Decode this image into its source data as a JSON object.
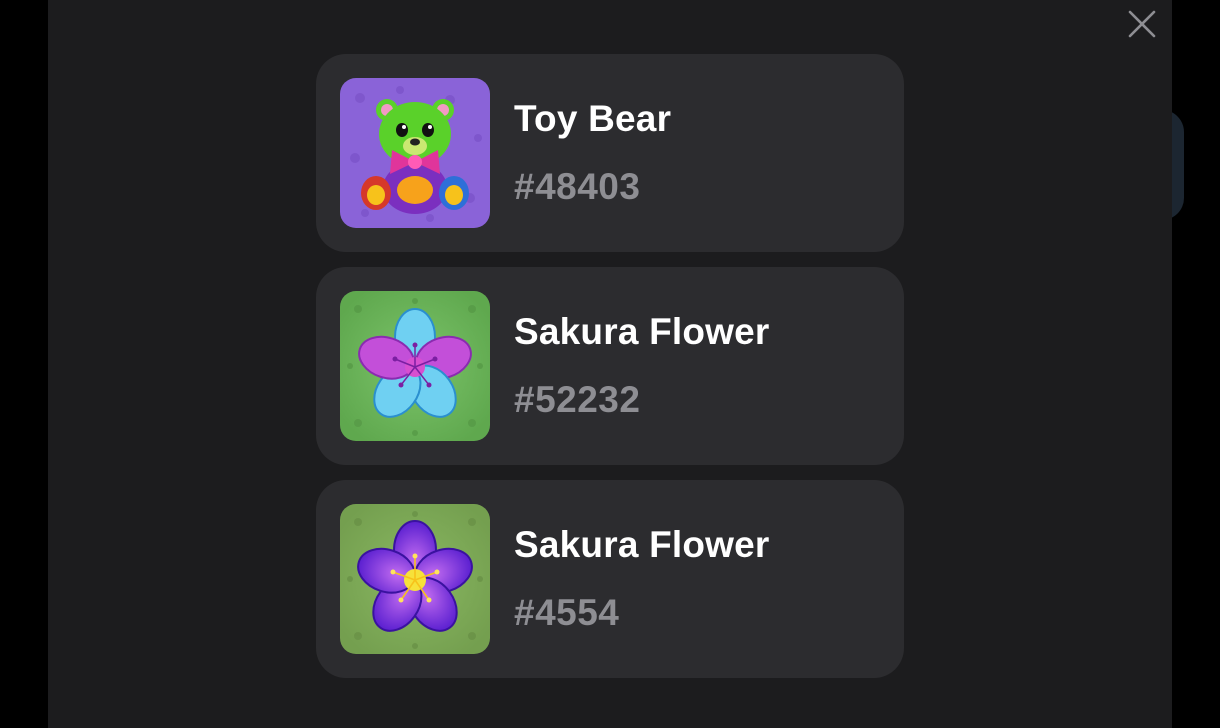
{
  "modal": {
    "close_icon": "close-icon"
  },
  "gifts": [
    {
      "name": "Toy Bear",
      "number": "#48403",
      "icon": "toy-bear-icon",
      "background_color": "#8a63d8"
    },
    {
      "name": "Sakura Flower",
      "number": "#52232",
      "icon": "sakura-flower-icon",
      "background_color": "#6db35a"
    },
    {
      "name": "Sakura Flower",
      "number": "#4554",
      "icon": "sakura-flower-icon",
      "background_color": "#7fa957"
    }
  ]
}
